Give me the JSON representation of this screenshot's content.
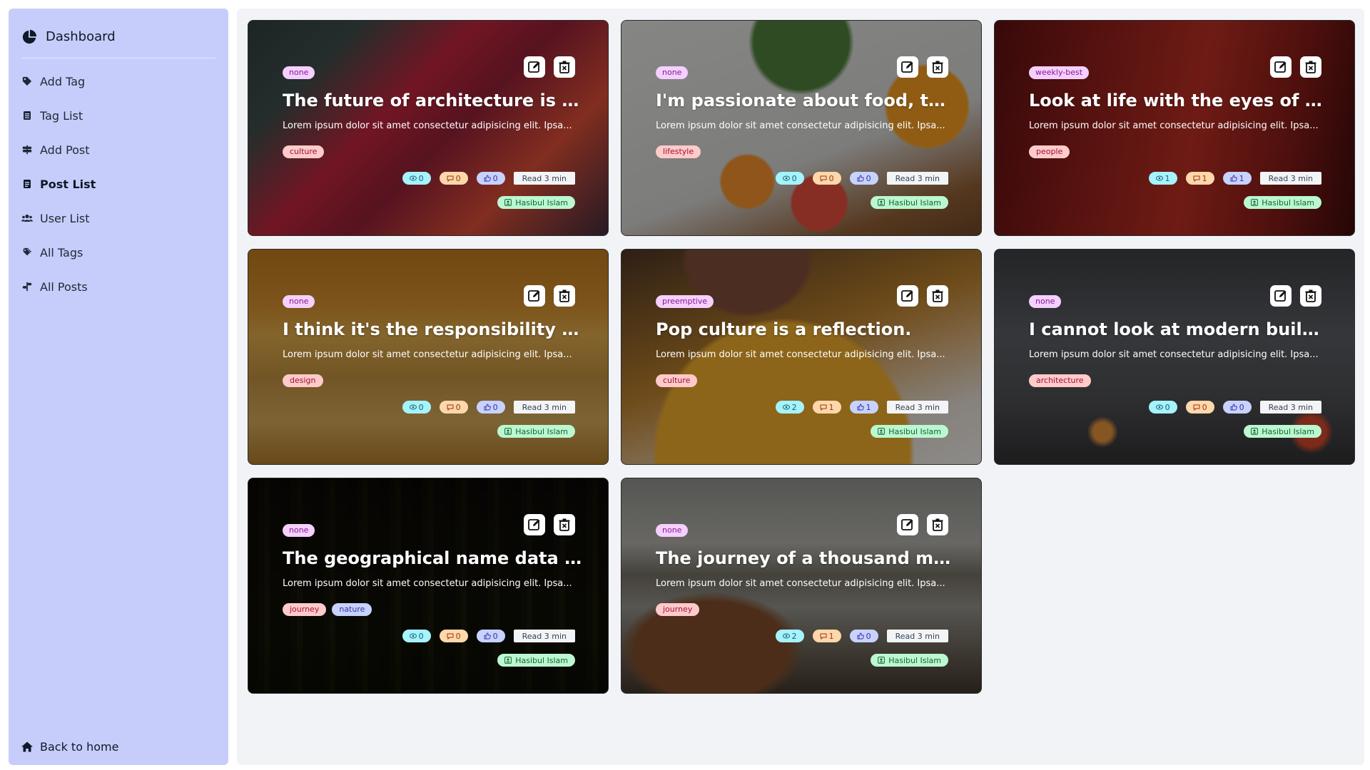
{
  "sidebar": {
    "brand": "Dashboard",
    "items": [
      {
        "label": "Add Tag",
        "icon": "tag-icon"
      },
      {
        "label": "Tag List",
        "icon": "list-icon"
      },
      {
        "label": "Add Post",
        "icon": "signpost-icon"
      },
      {
        "label": "Post List",
        "icon": "document-list-icon",
        "active": true
      },
      {
        "label": "User List",
        "icon": "users-icon"
      },
      {
        "label": "All Tags",
        "icon": "tags-icon"
      },
      {
        "label": "All Posts",
        "icon": "signpost-split-icon"
      }
    ],
    "home": "Back to home"
  },
  "colors": {
    "sidebar_bg": "#c7cdfb",
    "main_bg": "#f1f3f6"
  },
  "posts": [
    {
      "badge": "none",
      "title": "The future of architecture is cultu...",
      "excerpt": "Lorem ipsum dolor sit amet consectetur adipisicing elit. Ipsa...",
      "tags": [
        "culture"
      ],
      "views": "0",
      "comments": "0",
      "likes": "0",
      "read": "Read 3 min",
      "author": "Hasibul Islam",
      "image": "architecture staircase"
    },
    {
      "badge": "none",
      "title": "I'm passionate about food, the tr...",
      "excerpt": "Lorem ipsum dolor sit amet consectetur adipisicing elit. Ipsa...",
      "tags": [
        "lifestyle"
      ],
      "views": "0",
      "comments": "0",
      "likes": "0",
      "read": "Read 3 min",
      "author": "Hasibul Islam",
      "image": "apricots on table"
    },
    {
      "badge": "weekly-best",
      "title": "Look at life with the eyes of a child",
      "excerpt": "Lorem ipsum dolor sit amet consectetur adipisicing elit. Ipsa...",
      "tags": [
        "people"
      ],
      "views": "1",
      "comments": "1",
      "likes": "1",
      "read": "Read 3 min",
      "author": "Hasibul Islam",
      "image": "red interior"
    },
    {
      "badge": "none",
      "title": "I think it's the responsibility of a d...",
      "excerpt": "Lorem ipsum dolor sit amet consectetur adipisicing elit. Ipsa...",
      "tags": [
        "design"
      ],
      "views": "0",
      "comments": "0",
      "likes": "0",
      "read": "Read 3 min",
      "author": "Hasibul Islam",
      "image": "chairs orange room"
    },
    {
      "badge": "preemptive",
      "title": "Pop culture is a reflection.",
      "excerpt": "Lorem ipsum dolor sit amet consectetur adipisicing elit. Ipsa...",
      "tags": [
        "culture"
      ],
      "views": "2",
      "comments": "1",
      "likes": "1",
      "read": "Read 3 min",
      "author": "Hasibul Islam",
      "image": "person yellow sweater"
    },
    {
      "badge": "none",
      "title": "I cannot look at modern buildings...",
      "excerpt": "Lorem ipsum dolor sit amet consectetur adipisicing elit. Ipsa...",
      "tags": [
        "architecture"
      ],
      "views": "0",
      "comments": "0",
      "likes": "0",
      "read": "Read 3 min",
      "author": "Hasibul Islam",
      "image": "city street at night"
    },
    {
      "badge": "none",
      "title": "The geographical name data for ...",
      "excerpt": "Lorem ipsum dolor sit amet consectetur adipisicing elit. Ipsa...",
      "tags": [
        "journey",
        "nature"
      ],
      "views": "0",
      "comments": "0",
      "likes": "0",
      "read": "Read 3 min",
      "author": "Hasibul Islam",
      "image": "forest"
    },
    {
      "badge": "none",
      "title": "The journey of a thousand miles.",
      "excerpt": "Lorem ipsum dolor sit amet consectetur adipisicing elit. Ipsa...",
      "tags": [
        "journey"
      ],
      "views": "2",
      "comments": "1",
      "likes": "0",
      "read": "Read 3 min",
      "author": "Hasibul Islam",
      "image": "boat on lake"
    }
  ]
}
